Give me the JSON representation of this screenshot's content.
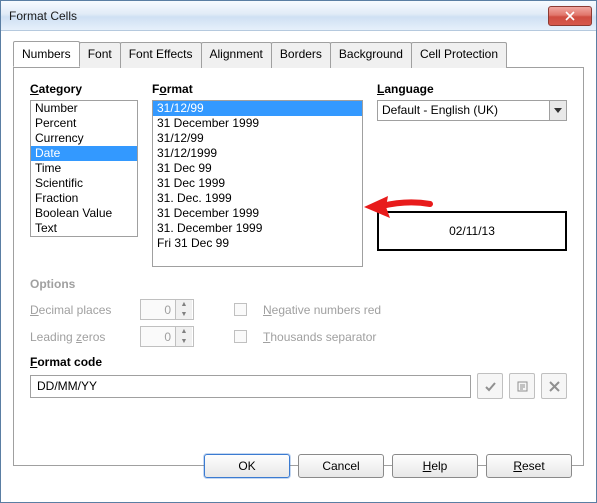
{
  "title": "Format Cells",
  "tabs": [
    "Numbers",
    "Font",
    "Font Effects",
    "Alignment",
    "Borders",
    "Background",
    "Cell Protection"
  ],
  "active_tab": 0,
  "labels": {
    "category": "Category",
    "format": "Format",
    "language": "Language",
    "options": "Options",
    "decimal_places": "Decimal places",
    "leading_zeros": "Leading zeros",
    "negative_red": "Negative numbers red",
    "thousands": "Thousands separator",
    "format_code": "Format code"
  },
  "category_items": [
    "Number",
    "Percent",
    "Currency",
    "Date",
    "Time",
    "Scientific",
    "Fraction",
    "Boolean Value",
    "Text"
  ],
  "category_selected": 3,
  "format_items": [
    "31/12/99",
    "31 December 1999",
    "31/12/99",
    "31/12/1999",
    "31 Dec 99",
    "31 Dec 1999",
    "31. Dec. 1999",
    "31 December 1999",
    "31. December 1999",
    "Fri 31 Dec 99"
  ],
  "format_selected": 0,
  "language_value": "Default - English (UK)",
  "preview_value": "02/11/13",
  "decimal_places_value": "0",
  "leading_zeros_value": "0",
  "negative_red_checked": false,
  "thousands_checked": false,
  "format_code_value": "DD/MM/YY",
  "buttons": {
    "ok": "OK",
    "cancel": "Cancel",
    "help": "Help",
    "reset": "Reset"
  }
}
